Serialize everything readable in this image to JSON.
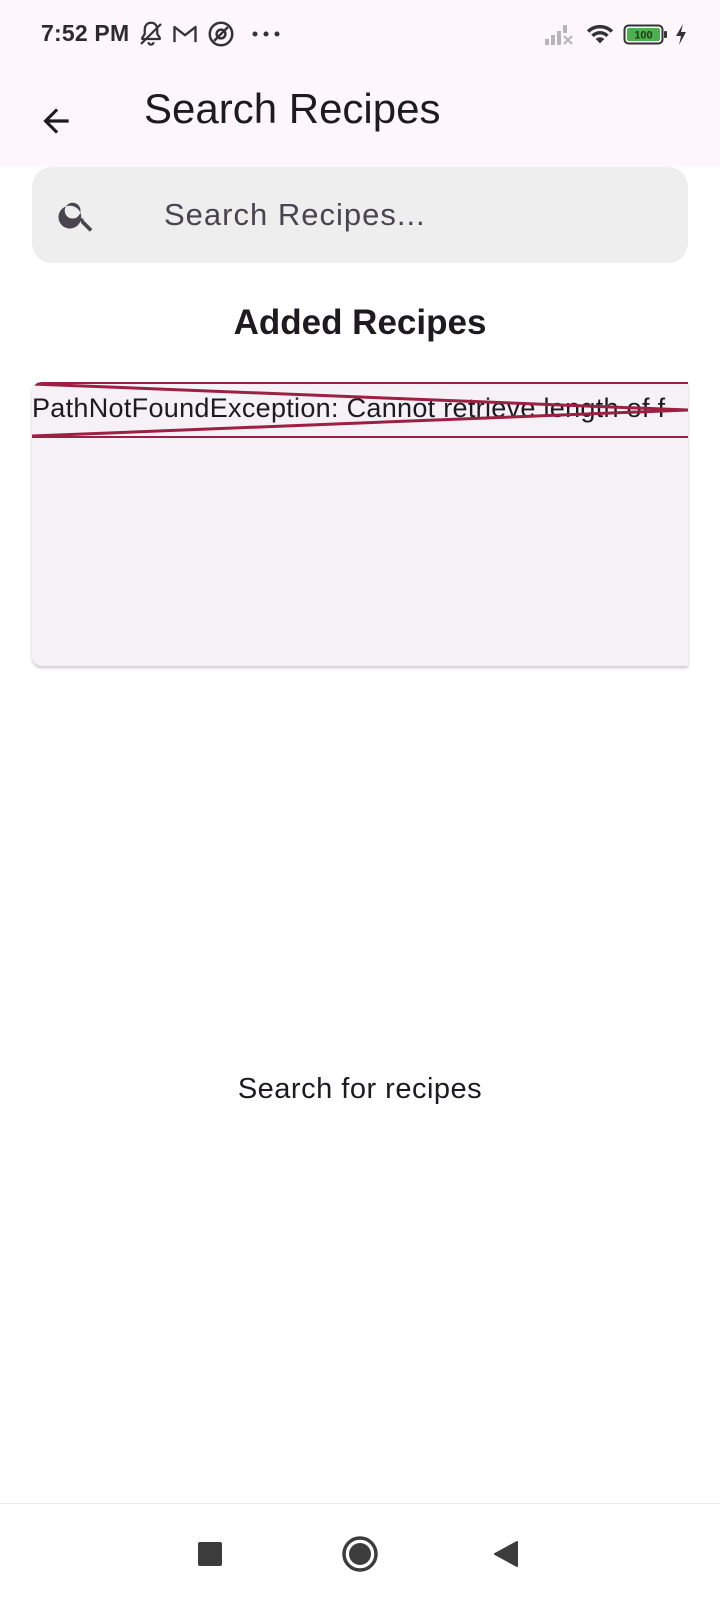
{
  "status_bar": {
    "time": "7:52 PM",
    "battery_level": "100",
    "left_icons": [
      "bell-off-icon",
      "gmail-icon",
      "at-sign-icon",
      "more-dots-icon"
    ],
    "right_icons": [
      "signal-off-icon",
      "wifi-icon",
      "battery-icon",
      "charging-bolt-icon"
    ],
    "battery_color": "#4caf50"
  },
  "app_bar": {
    "title": "Search Recipes",
    "background": "#fdf7fc"
  },
  "search": {
    "placeholder": "Search Recipes...",
    "value": ""
  },
  "added_recipes": {
    "heading": "Added Recipes",
    "error_text": "PathNotFoundException: Cannot retrieve length of f",
    "error_color": "#9c2042"
  },
  "empty_state": {
    "message": "Search for recipes"
  },
  "nav_bar": {
    "buttons": [
      "recents-square-icon",
      "home-circle-icon",
      "back-triangle-icon"
    ]
  }
}
